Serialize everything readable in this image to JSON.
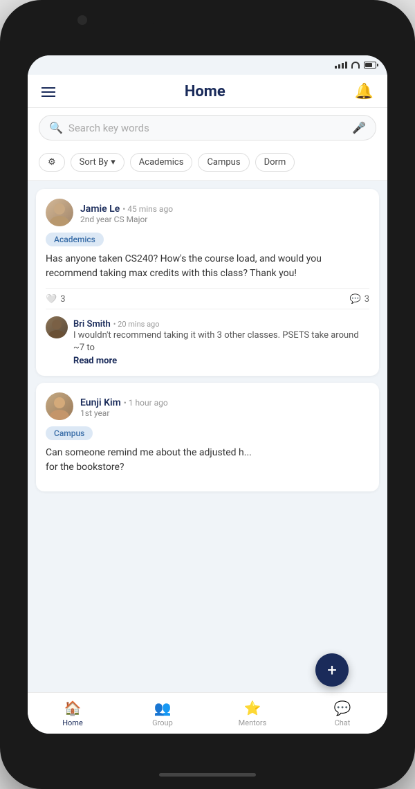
{
  "status_bar": {
    "battery": "60%",
    "wifi": true,
    "signal": true
  },
  "header": {
    "title": "Home",
    "hamburger_label": "Menu",
    "notification_label": "Notifications"
  },
  "search": {
    "placeholder": "Search key words",
    "mic_label": "Voice search"
  },
  "filters": [
    {
      "id": "filter-icon",
      "label": "",
      "icon": "⚙"
    },
    {
      "id": "sort",
      "label": "Sort By ▾"
    },
    {
      "id": "academics",
      "label": "Academics"
    },
    {
      "id": "campus",
      "label": "Campus"
    },
    {
      "id": "dorm",
      "label": "Dorm"
    }
  ],
  "posts": [
    {
      "id": "post-1",
      "author": "Jamie Le",
      "time": "45 mins ago",
      "subtitle": "2nd year CS Major",
      "tag": "Academics",
      "tag_style": "academics",
      "body": "Has anyone taken CS240? How's the course load, and would you recommend taking max credits with this class? Thank you!",
      "likes": 3,
      "comments": 3,
      "comment_preview": {
        "author": "Bri Smith",
        "time": "20 mins ago",
        "text": "I wouldn't recommend taking it with 3 other classes. PSETS take around ~7 to",
        "read_more": "Read more"
      }
    },
    {
      "id": "post-2",
      "author": "Eunji Kim",
      "time": "1 hour ago",
      "subtitle": "1st year",
      "tag": "Campus",
      "tag_style": "campus",
      "body": "Can someone remind me about the adjusted h... for the bookstore?",
      "likes": null,
      "comments": null,
      "comment_preview": null
    }
  ],
  "fab": {
    "label": "+",
    "action": "new-post"
  },
  "bottom_nav": [
    {
      "id": "home",
      "label": "Home",
      "icon": "🏠",
      "active": true
    },
    {
      "id": "group",
      "label": "Group",
      "icon": "👥",
      "active": false
    },
    {
      "id": "mentors",
      "label": "Mentors",
      "icon": "⭐",
      "active": false
    },
    {
      "id": "chat",
      "label": "Chat",
      "icon": "💬",
      "active": false
    }
  ]
}
